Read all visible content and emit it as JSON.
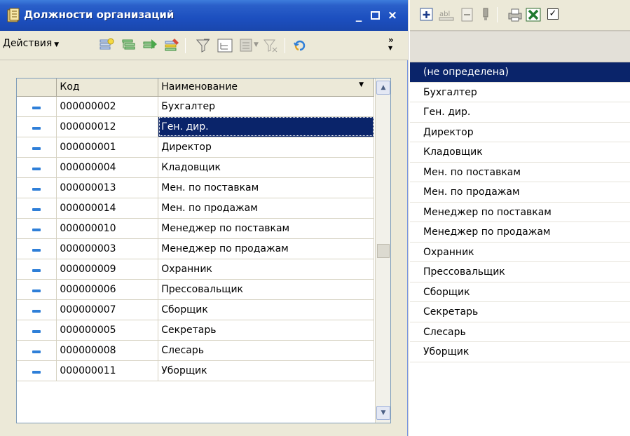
{
  "window": {
    "title": "Должности организаций",
    "minimize": "_",
    "close": "×"
  },
  "toolbar": {
    "actions_label": "Действия",
    "more_label": "»"
  },
  "table": {
    "columns": {
      "code": "Код",
      "name": "Наименование"
    },
    "rows": [
      {
        "code": "000000002",
        "name": "Бухгалтер"
      },
      {
        "code": "000000012",
        "name": "Ген. дир."
      },
      {
        "code": "000000001",
        "name": "Директор"
      },
      {
        "code": "000000004",
        "name": "Кладовщик"
      },
      {
        "code": "000000013",
        "name": "Мен. по поставкам"
      },
      {
        "code": "000000014",
        "name": "Мен. по продажам"
      },
      {
        "code": "000000010",
        "name": "Менеджер по поставкам"
      },
      {
        "code": "000000003",
        "name": "Менеджер по продажам"
      },
      {
        "code": "000000009",
        "name": "Охранник"
      },
      {
        "code": "000000006",
        "name": "Прессовальщик"
      },
      {
        "code": "000000007",
        "name": "Сборщик"
      },
      {
        "code": "000000005",
        "name": "Секретарь"
      },
      {
        "code": "000000008",
        "name": "Слесарь"
      },
      {
        "code": "000000011",
        "name": "Уборщик"
      }
    ],
    "selected_row_index": 1
  },
  "side_list": {
    "items": [
      "(не определена)",
      "Бухгалтер",
      "Ген. дир.",
      "Директор",
      "Кладовщик",
      "Мен. по поставкам",
      "Мен. по продажам",
      "Менеджер по поставкам",
      "Менеджер по продажам",
      "Охранник",
      "Прессовальщик",
      "Сборщик",
      "Секретарь",
      "Слесарь",
      "Уборщик"
    ],
    "selected_index": 0
  },
  "colors": {
    "titlebar": "#1c4fbf",
    "selection": "#0a246a",
    "row_marker": "#2f7fd8"
  }
}
